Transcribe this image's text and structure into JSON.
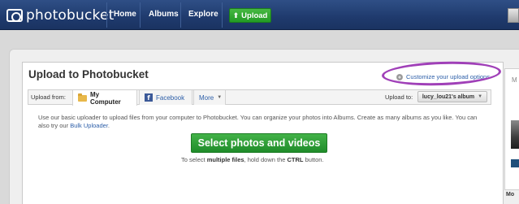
{
  "header": {
    "logo_text": "photobucket",
    "nav": [
      "Home",
      "Albums",
      "Explore"
    ],
    "upload_label": "Upload"
  },
  "card": {
    "title": "Upload to Photobucket",
    "customize_link": "Customize your upload options"
  },
  "tabs": {
    "upload_from_label": "Upload from:",
    "items": [
      {
        "label": "My Computer",
        "icon": "folder-icon",
        "active": true
      },
      {
        "label": "Facebook",
        "icon": "facebook-icon",
        "active": false
      },
      {
        "label": "More",
        "icon": "chevron-down-icon",
        "active": false
      }
    ],
    "upload_to_label": "Upload to:",
    "album": "lucy_lou21's album"
  },
  "body": {
    "description": "Use our basic uploader to upload files from your computer to Photobucket. You can organize your photos into Albums. Create as many albums as you like. You can also try our",
    "bulk_link": "Bulk Uploader",
    "select_button": "Select photos and videos",
    "hint_prefix": "To select",
    "hint_bold1": "multiple files",
    "hint_mid": ", hold down the",
    "hint_bold2": "CTRL",
    "hint_suffix": "button."
  },
  "right": {
    "label": "M",
    "mo": "Mo"
  },
  "colors": {
    "nav_bg": "#1f3a6d",
    "upload_green": "#239b25",
    "highlight": "#a040b8",
    "link": "#2c5ea8"
  }
}
